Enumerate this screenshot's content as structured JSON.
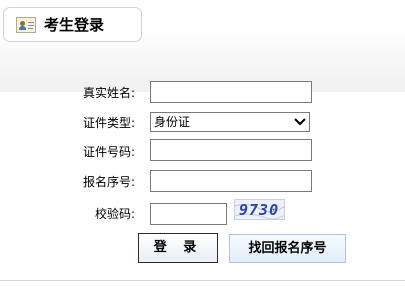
{
  "tab": {
    "title": "考生登录",
    "icon": "id-card-icon"
  },
  "form": {
    "name_label": "真实姓名:",
    "idtype_label": "证件类型:",
    "idtype_value": "身份证",
    "idnum_label": "证件号码:",
    "regnum_label": "报名序号:",
    "captcha_label": "校验码:",
    "captcha_text": "9730"
  },
  "buttons": {
    "login": "登 录",
    "find": "找回报名序号"
  },
  "colors": {
    "accent": "#2d47a8",
    "find_button_border": "#a9c5e8"
  }
}
